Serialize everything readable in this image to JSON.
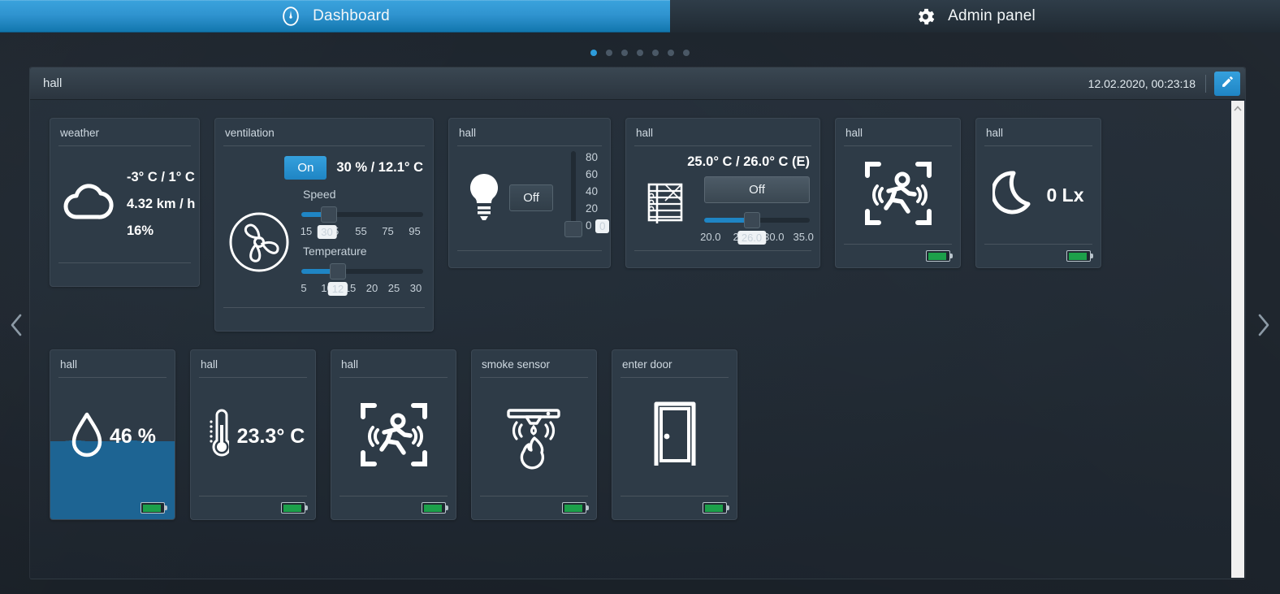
{
  "tabs": [
    {
      "label": "Dashboard",
      "icon": "gauge-icon",
      "active": true
    },
    {
      "label": "Admin panel",
      "icon": "gear-icon",
      "active": false
    }
  ],
  "pager": {
    "count": 7,
    "active_index": 0
  },
  "panel": {
    "title": "hall",
    "timestamp": "12.02.2020, 00:23:18",
    "edit_icon": "pencil-icon"
  },
  "nav": {
    "prev_icon": "chevron-left-icon",
    "next_icon": "chevron-right-icon"
  },
  "colors": {
    "accent": "#2d9cdb",
    "accent_button": "#1f85c4",
    "card_bg": "#2e3b47",
    "battery_green": "#1ca04a",
    "water_blue": "#1d6493"
  },
  "cards": {
    "weather": {
      "title": "weather",
      "icon": "cloud-icon",
      "temperature": "-3° C / 1° C",
      "wind": "4.32 km / h",
      "humidity": "16%"
    },
    "ventilation": {
      "title": "ventilation",
      "icon": "fan-icon",
      "power_label": "On",
      "readout": "30 %  /  12.1° C",
      "speed": {
        "label": "Speed",
        "value": 30,
        "bubble": "30",
        "min": 15,
        "max": 95,
        "ticks": [
          "15",
          "35",
          "55",
          "75",
          "95"
        ]
      },
      "temperature": {
        "label": "Temperature",
        "value": 12,
        "bubble": "12",
        "min": 5,
        "max": 30,
        "ticks": [
          "5",
          "10",
          "15",
          "20",
          "25",
          "30"
        ]
      }
    },
    "light": {
      "title": "hall",
      "icon": "lightbulb-icon",
      "state_label": "Off",
      "dimmer": {
        "value": 0,
        "bubble": "0",
        "ticks": [
          "80",
          "60",
          "40",
          "20",
          "0"
        ]
      }
    },
    "blinds": {
      "title": "hall",
      "icon": "blinds-icon",
      "readout": "25.0° C / 26.0° C (E)",
      "state_label": "Off",
      "slider": {
        "value": 26.0,
        "bubble": "26.0",
        "min": 20.0,
        "max": 35.0,
        "ticks": [
          "20.0",
          "25.0",
          "30.0",
          "35.0"
        ]
      }
    },
    "motion_top": {
      "title": "hall",
      "icon": "motion-sensor-icon",
      "battery": "battery-icon"
    },
    "lux": {
      "title": "hall",
      "icon": "moon-icon",
      "value": "0 Lx",
      "battery": "battery-icon"
    },
    "humidity": {
      "title": "hall",
      "icon": "water-drop-icon",
      "value": "46 %",
      "fill_percent": 46,
      "battery": "battery-icon"
    },
    "temperature": {
      "title": "hall",
      "icon": "thermometer-icon",
      "value": "23.3° C",
      "battery": "battery-icon"
    },
    "motion_bottom": {
      "title": "hall",
      "icon": "motion-sensor-icon",
      "battery": "battery-icon"
    },
    "smoke": {
      "title": "smoke sensor",
      "icon": "smoke-detector-icon",
      "battery": "battery-icon"
    },
    "door": {
      "title": "enter door",
      "icon": "door-icon",
      "battery": "battery-icon"
    }
  }
}
